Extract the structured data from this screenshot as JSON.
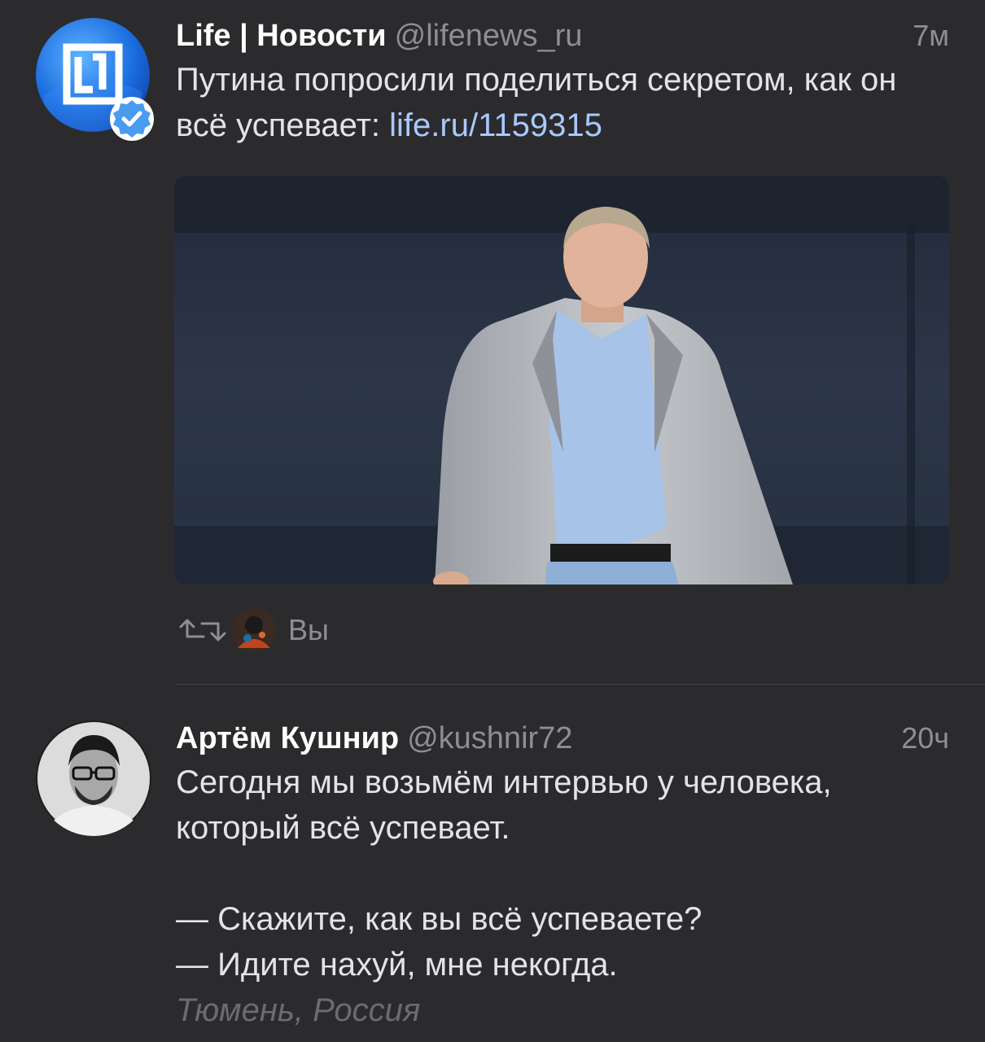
{
  "tweets": [
    {
      "author_name": "Life | Новости",
      "handle": "@lifenews_ru",
      "time": "7м",
      "text": "Путина попросили поделиться секретом, как он всё успевает: ",
      "link": "life.ru/1159315",
      "retweeted_by": "Вы",
      "verified": true
    },
    {
      "author_name": "Артём Кушнир",
      "handle": "@kushnir72",
      "time": "20ч",
      "text": "Сегодня мы возьмём интервью у человека, который всё успевает.\n\n— Скажите, как вы всё успеваете?\n— Идите нахуй, мне некогда.",
      "location": "Тюмень, Россия"
    }
  ],
  "icons": {
    "retweet": "retweet-icon",
    "verified": "verified-badge-icon"
  },
  "colors": {
    "background": "#2b2b2d",
    "link": "#a9c9ff",
    "muted": "#8e8e93",
    "verified": "#4a9cf0"
  }
}
